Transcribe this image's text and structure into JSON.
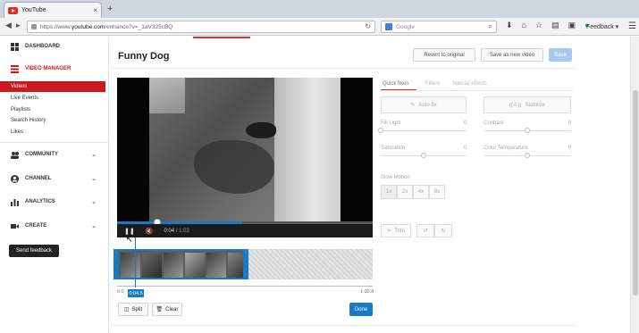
{
  "browser": {
    "tab_title": "YouTube",
    "tab_close": "×",
    "new_tab": "+",
    "url_prefix": "https://www.",
    "url_host": "youtube.com",
    "url_rest": "/enhance?v=_1aV325cBQ",
    "search_placeholder": "Google",
    "feedback_menu": "Feedback ▾"
  },
  "sidebar": {
    "dashboard": "DASHBOARD",
    "video_manager": "VIDEO MANAGER",
    "sub_items": [
      "Videos",
      "Live Events",
      "Playlists",
      "Search History",
      "Likes"
    ],
    "community": "COMMUNITY",
    "channel": "CHANNEL",
    "analytics": "ANALYTICS",
    "create": "CREATE",
    "send_feedback": "Send feedback"
  },
  "header": {
    "title": "Funny Dog",
    "revert": "Revert to original",
    "save_new": "Save as new video",
    "save": "Save"
  },
  "player": {
    "current_time": "0:04",
    "duration": "/ 1:03",
    "progress": 0.49
  },
  "timeline": {
    "start_label": "0:0",
    "playhead_label": "0:04.5",
    "end_label": "1:03.8",
    "split": "Split",
    "clear": "Clear",
    "done": "Done"
  },
  "panel": {
    "tabs": [
      "Quick fixes",
      "Filters",
      "Special effects"
    ],
    "auto_fix": "Auto-fix",
    "stabilize": "Stabilize",
    "sliders": [
      {
        "label": "Fill Light",
        "value": "0",
        "level": 0.0
      },
      {
        "label": "Contrast",
        "value": "0",
        "level": 0.5
      },
      {
        "label": "Saturation",
        "value": "0",
        "level": 0.5
      },
      {
        "label": "Color Temperature",
        "value": "0",
        "level": 0.5
      }
    ],
    "slow_motion_label": "Slow Motion",
    "slow_motion_options": [
      "1x",
      "2x",
      "4x",
      "8x"
    ],
    "trim": "Trim"
  },
  "colors": {
    "accent_blue": "#167ac6",
    "youtube_red": "#cc181e"
  }
}
